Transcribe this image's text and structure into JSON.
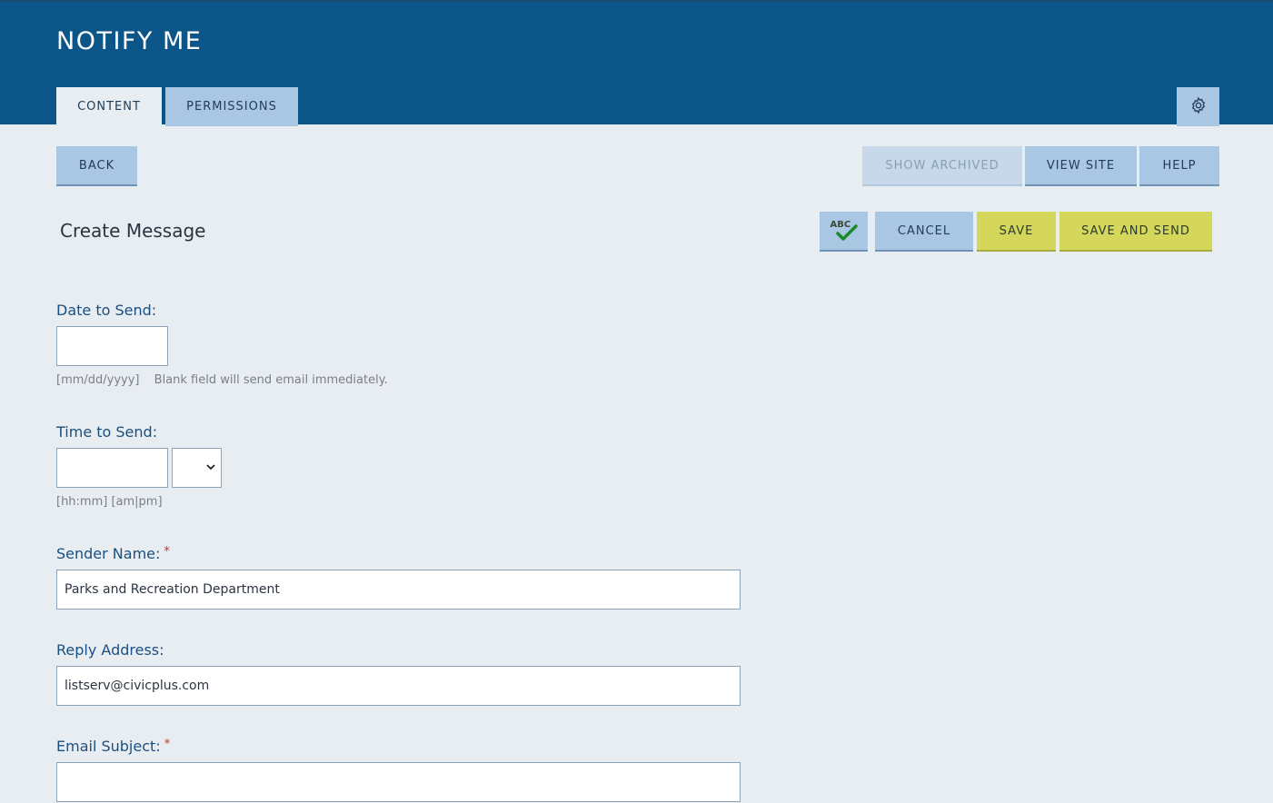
{
  "header": {
    "title": "NOTIFY ME",
    "tabs": [
      {
        "label": "CONTENT",
        "active": true
      },
      {
        "label": "PERMISSIONS",
        "active": false
      }
    ],
    "settings_icon": "gear-icon"
  },
  "toolbar": {
    "back_label": "BACK",
    "show_archived_label": "SHOW ARCHIVED",
    "view_site_label": "VIEW SITE",
    "help_label": "HELP"
  },
  "page": {
    "title": "Create Message",
    "spellcheck_icon": "spellcheck-icon",
    "spellcheck_text": "ABC",
    "cancel_label": "CANCEL",
    "save_label": "SAVE",
    "save_and_send_label": "SAVE AND SEND"
  },
  "form": {
    "date": {
      "label": "Date to Send:",
      "value": "",
      "hint_format": "[mm/dd/yyyy]",
      "hint_text": "Blank field will send email immediately."
    },
    "time": {
      "label": "Time to Send:",
      "value": "",
      "ampm_value": "",
      "hint": "[hh:mm] [am|pm]"
    },
    "sender_name": {
      "label": "Sender Name:",
      "required_mark": "*",
      "value": "Parks and Recreation Department"
    },
    "reply_address": {
      "label": "Reply Address:",
      "value": "listserv@civicplus.com"
    },
    "email_subject": {
      "label": "Email Subject:",
      "required_mark": "*",
      "value": ""
    }
  },
  "colors": {
    "header_bg": "#0c5588",
    "page_bg": "#e8edf2",
    "button_blue": "#a9c6e3",
    "button_yellow": "#d4d75c",
    "label_blue": "#1a4f80"
  }
}
